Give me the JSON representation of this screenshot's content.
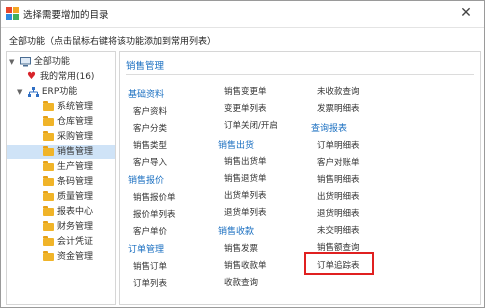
{
  "window": {
    "title": "选择需要增加的目录",
    "close_glyph": "✕"
  },
  "subtitle": "全部功能（点击鼠标右键将该功能添加到常用列表）",
  "tree": {
    "root": "全部功能",
    "favorites": "我的常用(16)",
    "erp": "ERP功能",
    "items": [
      "系统管理",
      "仓库管理",
      "采购管理",
      "销售管理",
      "生产管理",
      "条码管理",
      "质量管理",
      "报表中心",
      "财务管理",
      "会计凭证",
      "资金管理"
    ],
    "selected_index": 3
  },
  "panel": {
    "title": "销售管理",
    "sections": {
      "basic": "基础资料",
      "quote": "销售报价",
      "order": "订单管理",
      "outbound": "销售出货",
      "collection": "销售收款",
      "report": "查询报表"
    },
    "col1": {
      "basic": [
        "客户资料",
        "客户分类",
        "销售类型",
        "客户导入"
      ],
      "quote": [
        "销售报价单",
        "报价单列表",
        "客户单价"
      ],
      "order": [
        "销售订单",
        "订单列表"
      ]
    },
    "col2": {
      "top": [
        "销售变更单",
        "变更单列表",
        "订单关闭/开启"
      ],
      "outbound": [
        "销售出货单",
        "销售退货单",
        "出货单列表",
        "退货单列表"
      ],
      "collection": [
        "销售发票",
        "销售收款单",
        "收款查询"
      ]
    },
    "col3": {
      "top": [
        "未收款查询",
        "发票明细表"
      ],
      "report": [
        "订单明细表",
        "客户对账单",
        "销售明细表",
        "出货明细表",
        "退货明细表",
        "未交明细表",
        "销售额查询",
        "订单追踪表"
      ]
    },
    "highlighted": "订单追踪表"
  }
}
